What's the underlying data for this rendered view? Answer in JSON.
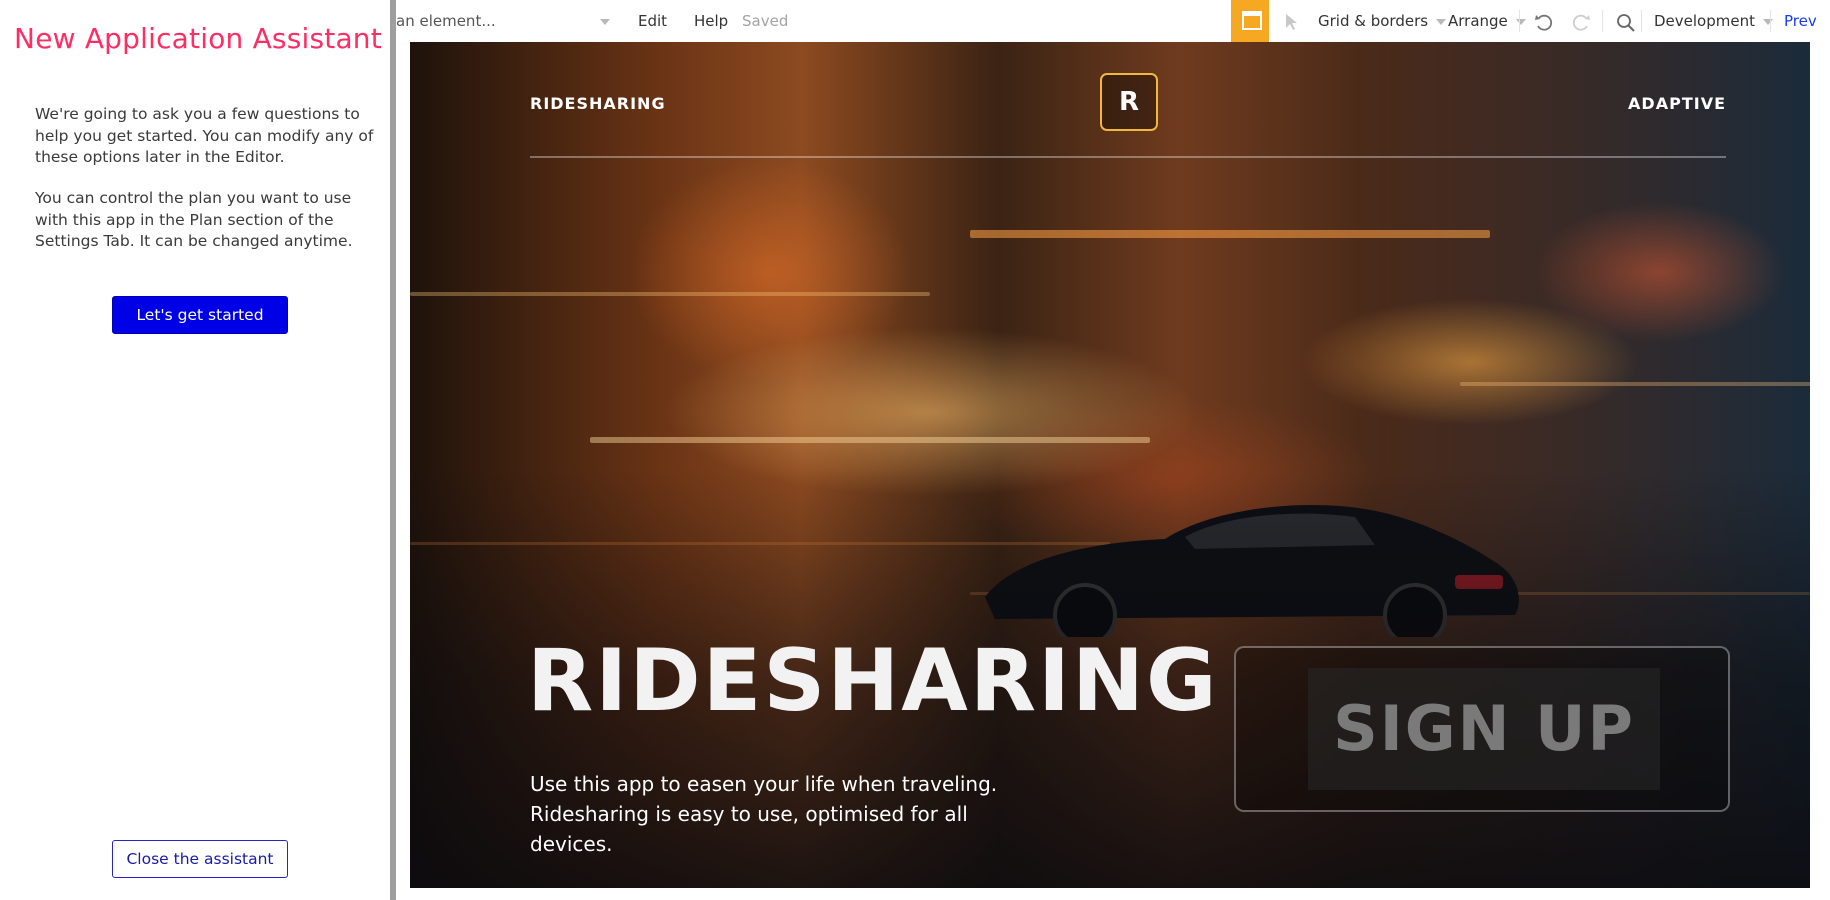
{
  "assistant": {
    "title": "New Application Assistant",
    "intro": "We're going to ask you a few questions to help you get started. You can modify any of these options later in the Editor.",
    "plan_note": "You can control the plan you want to use with this app in the Plan section of the Settings Tab. It can be changed anytime.",
    "start_button": "Let's get started",
    "close_button": "Close the assistant"
  },
  "toolbar": {
    "element_search": "an element...",
    "edit": "Edit",
    "help": "Help",
    "status": "Saved",
    "grid": "Grid & borders",
    "arrange": "Arrange",
    "environment": "Development",
    "preview": "Prev",
    "icons": [
      "pointer-icon",
      "undo-icon",
      "redo-icon",
      "search-icon"
    ],
    "accent": "#f6a823"
  },
  "canvas": {
    "nav_left": "RIDESHARING",
    "logo_letter": "R",
    "nav_right": "ADAPTIVE",
    "hero_title": "RIDESHARING",
    "hero_line1": "Use this app to easen your life when traveling.",
    "hero_line2": "Ridesharing is easy to use, optimised for all devices.",
    "signup": "SIGN UP"
  },
  "colors": {
    "assistant_title": "#ff2d63",
    "primary_button": "#0000e6",
    "logo_border": "#f0b840"
  }
}
